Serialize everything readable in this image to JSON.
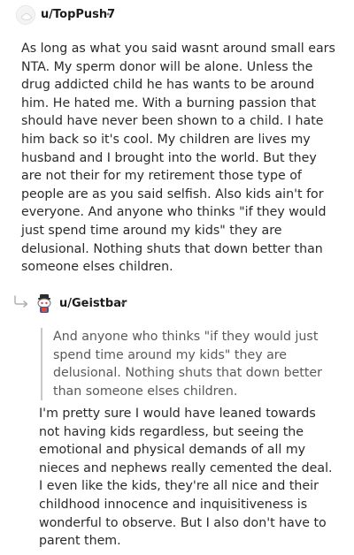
{
  "comments": [
    {
      "author": "u/TopPush7",
      "separator": "•",
      "avatar_icon": "default-user-avatar-icon",
      "body": "As long as what you said wasnt around small ears NTA. My sperm donor will be alone. Unless the drug addicted child he has wants to be around him. He hated me. With a burning passion that should have never been shown to a child. I hate him back so it's cool. My children are lives my husband and I brought into the world. But they are not their for my retirement those type of people are as you said selfish. Also kids ain't for everyone. And anyone who thinks \"if they would just spend time around my kids\" they are delusional. Nothing shuts that down better than someone elses children."
    },
    {
      "author": "u/Geistbar",
      "separator": "•",
      "avatar_icon": "snoo-avatar-icon",
      "reply_icon": "reply-arrow-icon",
      "quote": "And anyone who thinks \"if they would just spend time around my kids\" they are delusional. Nothing shuts that down better than someone elses children.",
      "body": "I'm pretty sure I would have leaned towards not having kids regardless, but seeing the emotional and physical demands of all my nieces and nephews really cemented the deal. I even like the kids, they're all nice and their childhood innocence and inquisitiveness is wonderful to observe. But I also don't have to parent them."
    }
  ]
}
